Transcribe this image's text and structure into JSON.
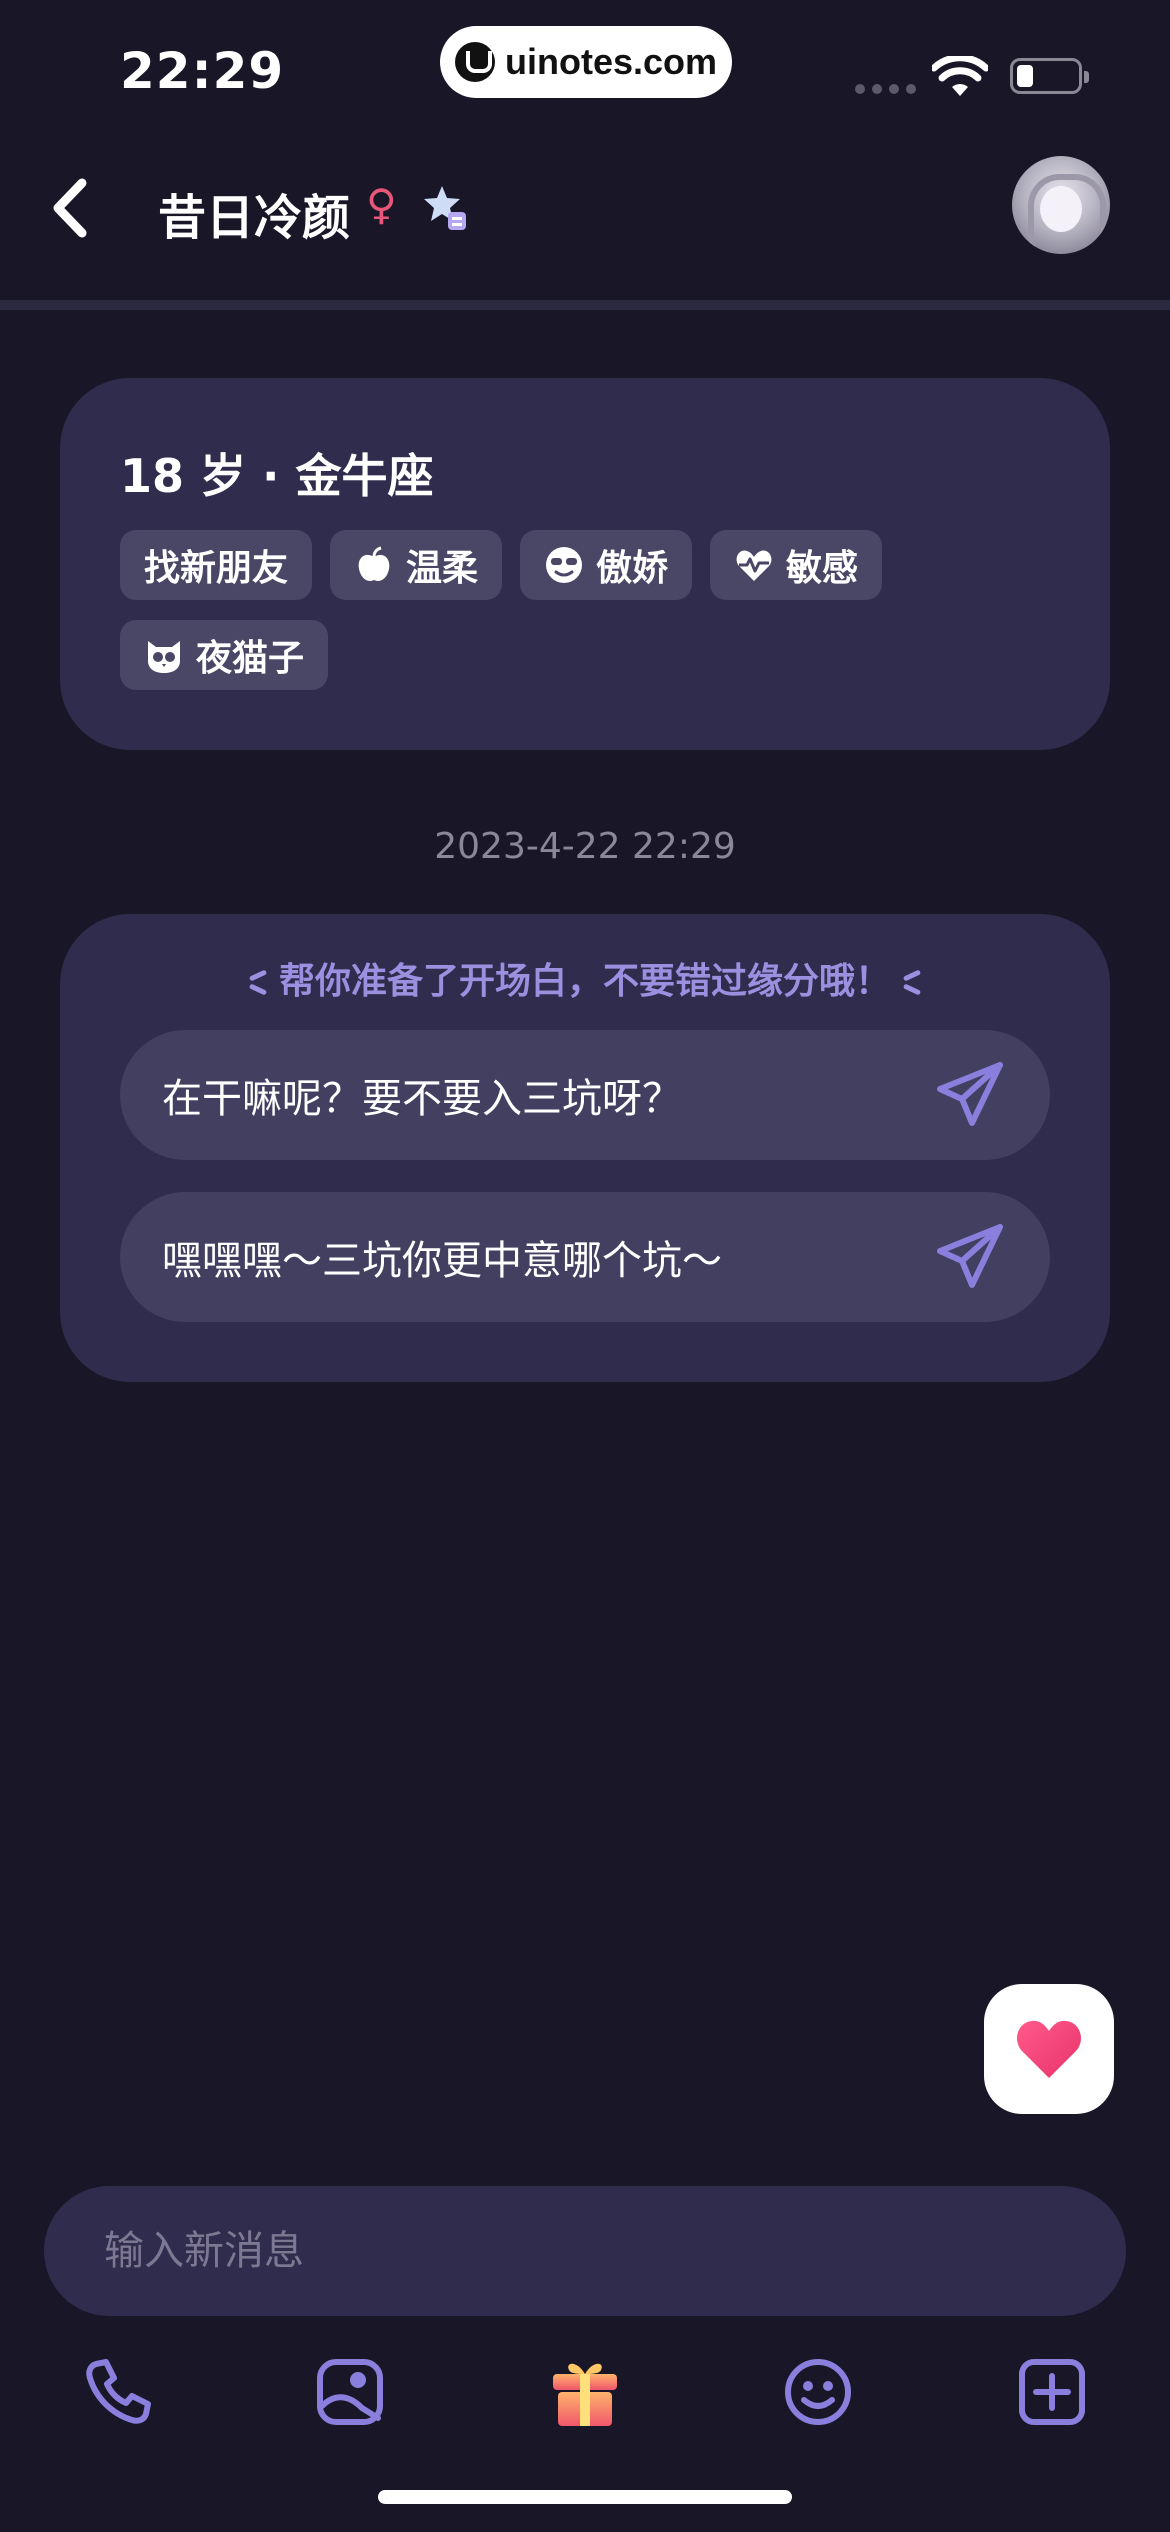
{
  "status_bar": {
    "time": "22:29",
    "watermark": "uinotes.com"
  },
  "header": {
    "nickname": "昔日冷颜",
    "gender_symbol": "♀",
    "icons": [
      "back-chevron-icon",
      "star-badge-icon",
      "avatar"
    ]
  },
  "profile": {
    "summary": "18 岁 · 金牛座",
    "tags": [
      {
        "label": "找新朋友",
        "icon": ""
      },
      {
        "label": "温柔",
        "icon": "apple-icon"
      },
      {
        "label": "傲娇",
        "icon": "cool-face-icon"
      },
      {
        "label": "敏感",
        "icon": "heartbeat-icon"
      },
      {
        "label": "夜猫子",
        "icon": "owl-icon"
      }
    ]
  },
  "chat": {
    "timestamp": "2023-4-22 22:29",
    "opener_hint": "帮你准备了开场白，不要错过缘分哦！",
    "openers": [
      "在干嘛呢？要不要入三坑呀？",
      "嘿嘿嘿～三坑你更中意哪个坑～"
    ]
  },
  "composer": {
    "placeholder": "输入新消息"
  },
  "toolbar": {
    "items": [
      "phone-icon",
      "image-icon",
      "gift-icon",
      "emoji-icon",
      "plus-icon"
    ]
  },
  "colors": {
    "background": "#181627",
    "card": "#302c4d",
    "accent": "#8a7fdc",
    "gender": "#e8577a",
    "heart": "#f0467a"
  }
}
